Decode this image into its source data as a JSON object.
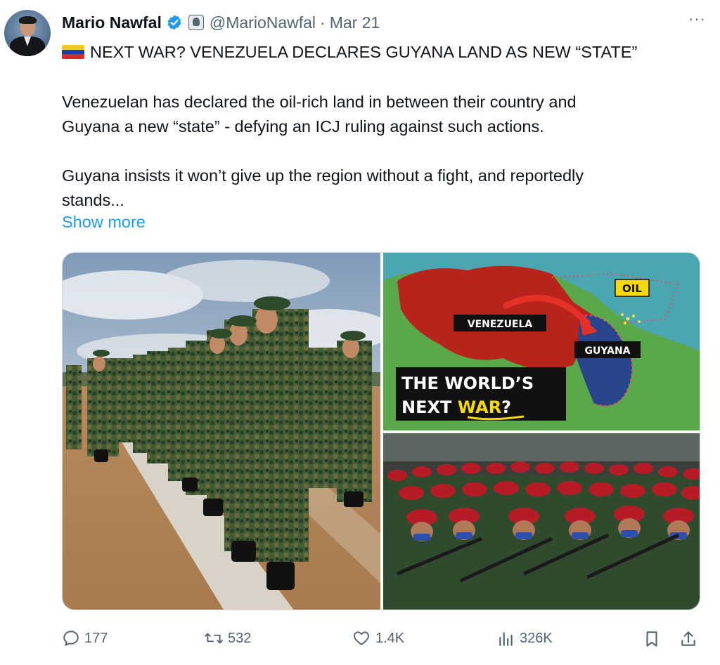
{
  "tweet": {
    "author": {
      "name": "Mario Nawfal",
      "handle": "@MarioNawfal",
      "date": "Mar 21",
      "verified": true
    },
    "more_label": "···",
    "text_lines": [
      "NEXT WAR? VENEZUELA DECLARES GUYANA LAND AS NEW “STATE”",
      "Venezuelan has declared the oil-rich land in between their country and",
      "Guyana a new “state” - defying an ICJ ruling against such actions.",
      "Guyana insists it won’t give up the region without a fight, and reportedly",
      "stands..."
    ],
    "show_more": "Show more",
    "map_labels": {
      "oil": "OIL",
      "venezuela": "VENEZUELA",
      "guyana": "GUYANA",
      "headline_1": "THE WORLD’S",
      "headline_2a": "NEXT ",
      "headline_2b": "WAR",
      "headline_2c": "?"
    },
    "stats": {
      "replies": "177",
      "reposts": "532",
      "likes": "1.4K",
      "views": "326K"
    }
  },
  "colors": {
    "accent": "#1d9bf0",
    "secondary_text": "#536471",
    "flag": [
      "#f4c81c",
      "#1a3f9e",
      "#d62b2b"
    ]
  },
  "icons": [
    "verified-badge-icon",
    "affiliate-badge-icon",
    "more-icon",
    "venezuela-flag-icon",
    "reply-icon",
    "repost-icon",
    "like-icon",
    "views-icon",
    "bookmark-icon",
    "share-icon"
  ]
}
